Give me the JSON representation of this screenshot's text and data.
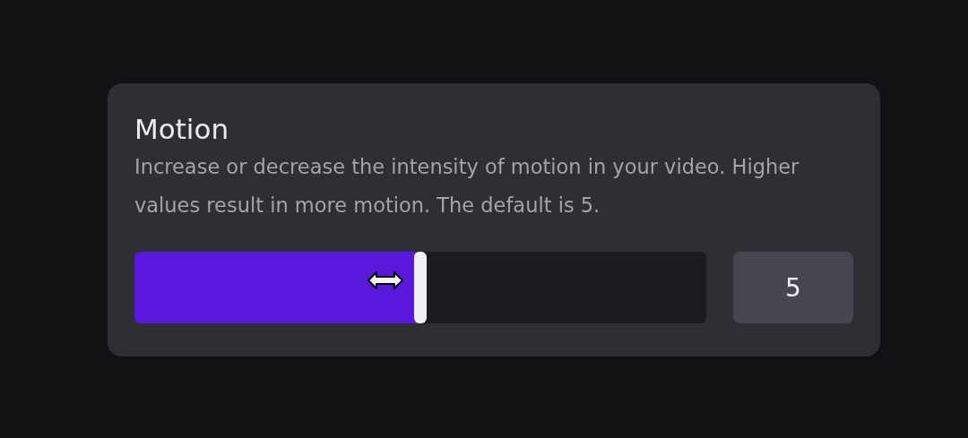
{
  "setting": {
    "title": "Motion",
    "description": "Increase or decrease the intensity of motion in your video. Higher values result in more motion. The default is 5.",
    "slider": {
      "level": 0.5
    },
    "value": "5"
  }
}
